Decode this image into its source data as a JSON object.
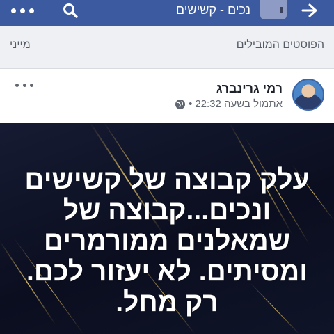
{
  "topbar": {
    "title": "נכים - קשישים",
    "icons": {
      "menu": "more-dots-icon",
      "search": "search-icon",
      "back": "arrow-right-icon"
    },
    "bg_color": "#3b5aa0"
  },
  "subbar": {
    "title": "הפוסטים המובילים",
    "sort_label": "מייני"
  },
  "post": {
    "author": "רמי גרינברג",
    "time": "אתמול בשעה 22:32",
    "separator": "•",
    "privacy_icon": "globe-icon",
    "menu_icon": "more-dots-icon",
    "image_text": "עלק קבוצה של קשישים ונכים...קבוצה של שמאלנים ממורמרים ומסיתים. לא יעזור לכם. רק מחל."
  }
}
